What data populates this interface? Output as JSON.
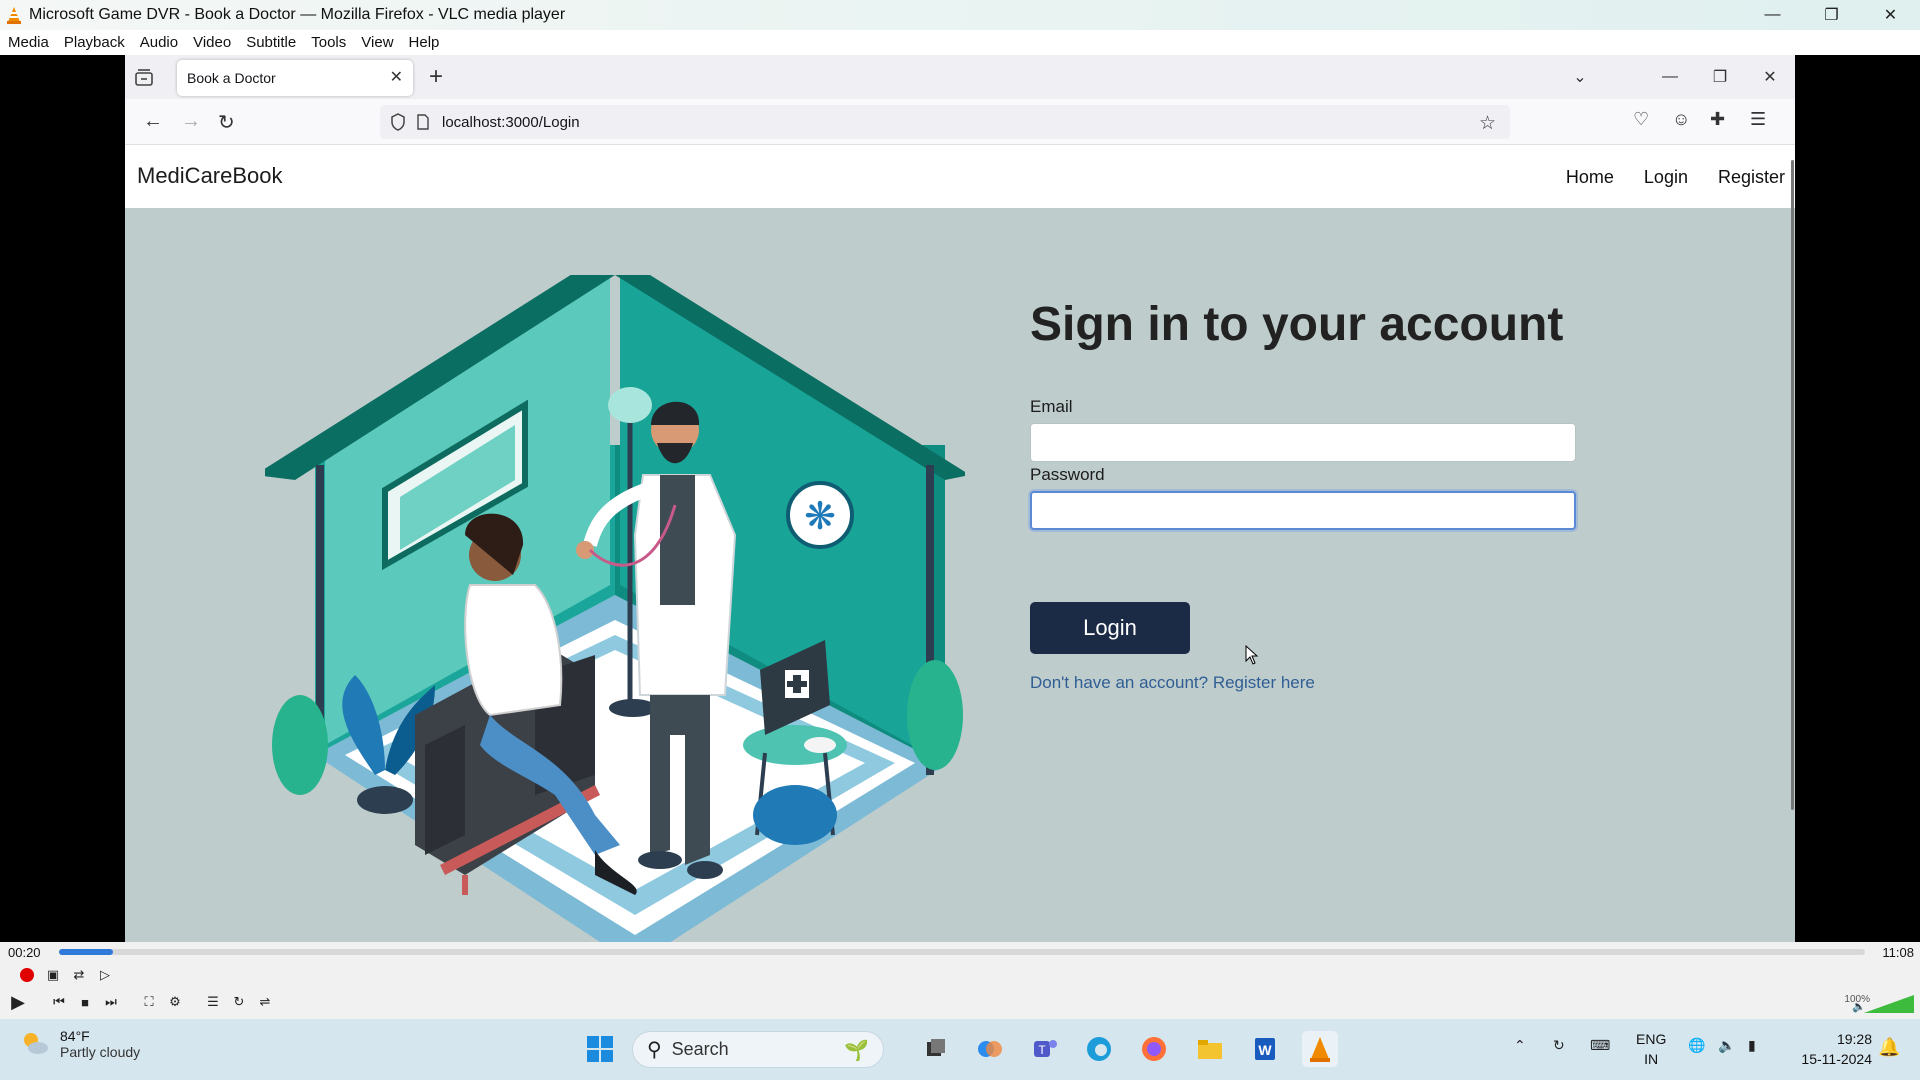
{
  "vlc": {
    "title": "Microsoft Game DVR - Book a Doctor — Mozilla Firefox - VLC media player",
    "menu": [
      "Media",
      "Playback",
      "Audio",
      "Video",
      "Subtitle",
      "Tools",
      "View",
      "Help"
    ],
    "time_elapsed": "00:20",
    "time_total": "11:08",
    "progress": 0.03,
    "volume": "100%"
  },
  "firefox": {
    "tab_title": "Book a Doctor",
    "url": "localhost:3000/Login"
  },
  "site": {
    "brand": "MediCareBook",
    "nav": [
      "Home",
      "Login",
      "Register"
    ],
    "heading": "Sign in to your account",
    "email_label": "Email",
    "email_value": "",
    "password_label": "Password",
    "password_value": "",
    "login_button": "Login",
    "register_link": "Don't have an account? Register here"
  },
  "taskbar": {
    "temperature": "84°F",
    "condition": "Partly cloudy",
    "search_placeholder": "Search",
    "lang": "ENG",
    "region": "IN",
    "time": "19:28",
    "date": "15-11-2024"
  },
  "colors": {
    "page_bg": "#bfcccc",
    "button_bg": "#1c2b45",
    "link": "#2f5e94",
    "teal": "#16a596"
  }
}
